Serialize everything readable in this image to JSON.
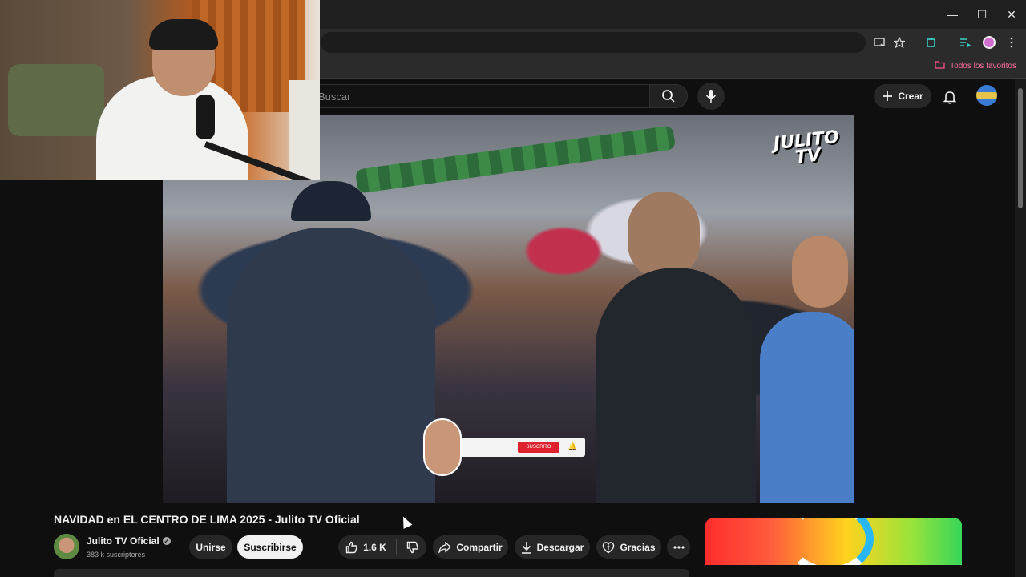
{
  "browser": {
    "bookmarks_bar": {
      "folder_label": "Todos los favoritos"
    },
    "window_controls": [
      "minimize",
      "maximize",
      "close"
    ]
  },
  "youtube": {
    "search": {
      "placeholder": "Buscar"
    },
    "create_label": "Crear",
    "icons": {
      "search": "search-icon",
      "mic": "mic-icon",
      "bell": "bell-icon",
      "plus": "plus-icon"
    }
  },
  "video": {
    "watermark_line1": "JULITO",
    "watermark_line2": "TV",
    "subscribe_overlay_button": "SUSCRITO"
  },
  "below_video": {
    "title": "NAVIDAD en EL CENTRO DE LIMA 2025 - Julito TV Oficial",
    "channel_name": "Julito TV Oficial",
    "subscribers": "383 k suscriptores",
    "join_label": "Unirse",
    "subscribe_label": "Suscribirse",
    "like_count": "1.6 K",
    "share_label": "Compartir",
    "download_label": "Descargar",
    "thanks_label": "Gracias"
  },
  "colors": {
    "background": "#0f0f0f",
    "pill": "#272727",
    "accent_bookmark": "#ff4d8d",
    "subscribe_red": "#e0222e"
  }
}
